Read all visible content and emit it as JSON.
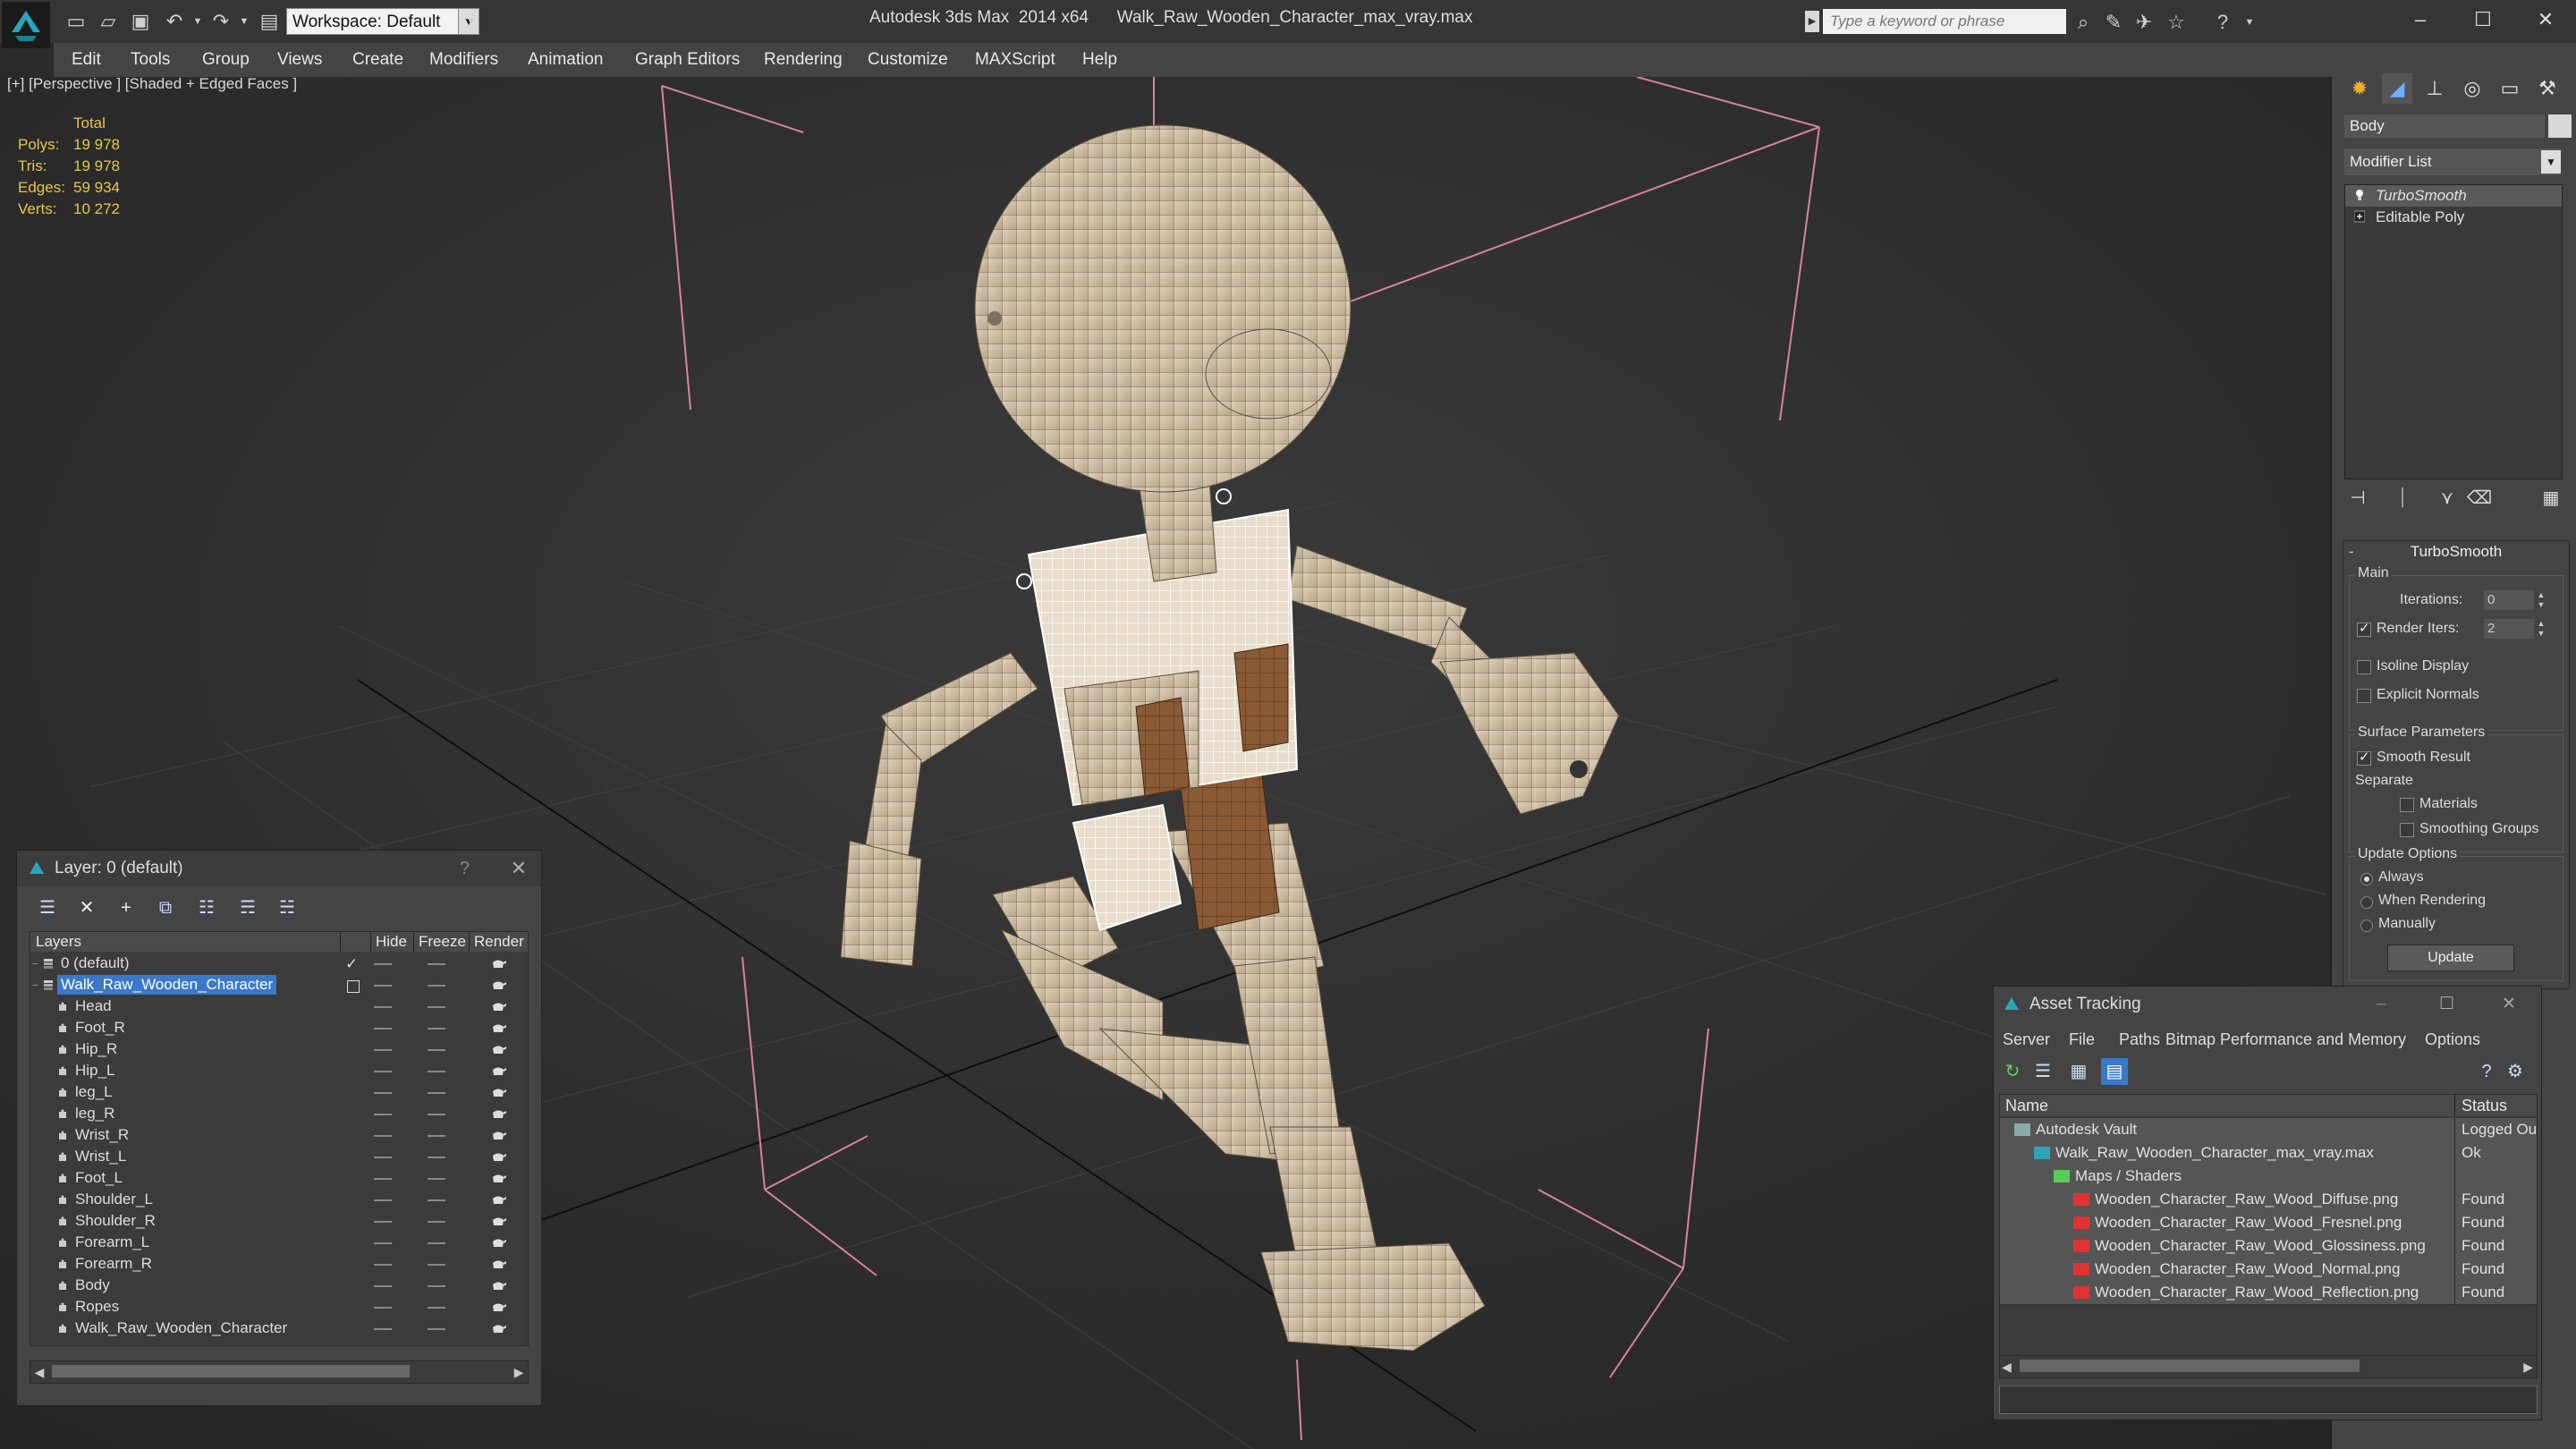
{
  "app": {
    "title": "Autodesk 3ds Max  2014 x64",
    "file": "Walk_Raw_Wooden_Character_max_vray.max",
    "workspace": "Workspace: Default",
    "search_placeholder": "Type a keyword or phrase",
    "logo_icon": "3dsmax-logo-icon",
    "accent": "#3a78c8"
  },
  "menu": [
    "Edit",
    "Tools",
    "Group",
    "Views",
    "Create",
    "Modifiers",
    "Animation",
    "Graph Editors",
    "Rendering",
    "Customize",
    "MAXScript",
    "Help"
  ],
  "viewport": {
    "label": "[+] [Perspective ] [Shaded + Edged Faces ]",
    "stats_header": "Total",
    "stats": [
      {
        "k": "Polys:",
        "v": "19 978"
      },
      {
        "k": "Tris:",
        "v": "19 978"
      },
      {
        "k": "Edges:",
        "v": "59 934"
      },
      {
        "k": "Verts:",
        "v": "10 272"
      }
    ]
  },
  "command_panel": {
    "tabs": [
      "create-icon",
      "modify-icon",
      "hierarchy-icon",
      "motion-icon",
      "display-icon",
      "utilities-icon"
    ],
    "object_name": "Body",
    "modifier_list": "Modifier List",
    "stack": [
      {
        "label": "TurboSmooth",
        "selected": true
      },
      {
        "label": "Editable Poly",
        "selected": false
      }
    ],
    "rollout": {
      "title": "TurboSmooth",
      "main_label": "Main",
      "iterations_label": "Iterations:",
      "iterations_value": "0",
      "render_iters_label": "Render Iters:",
      "render_iters_value": "2",
      "render_iters_checked": true,
      "isoline": "Isoline Display",
      "explicit": "Explicit Normals",
      "surface_label": "Surface Parameters",
      "smooth_result": "Smooth Result",
      "separate": "Separate",
      "materials": "Materials",
      "smoothing_groups": "Smoothing Groups",
      "update_label": "Update Options",
      "always": "Always",
      "when_rendering": "When Rendering",
      "manually": "Manually",
      "update_button": "Update"
    }
  },
  "layer_dialog": {
    "title": "Layer: 0 (default)",
    "help": "?",
    "columns": {
      "layers": "Layers",
      "hide": "Hide",
      "freeze": "Freeze",
      "render": "Render"
    },
    "rows": [
      {
        "name": "0 (default)",
        "indent": 1,
        "layer": true,
        "sel": false,
        "active": true
      },
      {
        "name": "Walk_Raw_Wooden_Character",
        "indent": 1,
        "layer": true,
        "sel": true,
        "active": false
      },
      {
        "name": "Head",
        "indent": 2
      },
      {
        "name": "Foot_R",
        "indent": 2
      },
      {
        "name": "Hip_R",
        "indent": 2
      },
      {
        "name": "Hip_L",
        "indent": 2
      },
      {
        "name": "leg_L",
        "indent": 2
      },
      {
        "name": "leg_R",
        "indent": 2
      },
      {
        "name": "Wrist_R",
        "indent": 2
      },
      {
        "name": "Wrist_L",
        "indent": 2
      },
      {
        "name": "Foot_L",
        "indent": 2
      },
      {
        "name": "Shoulder_L",
        "indent": 2
      },
      {
        "name": "Shoulder_R",
        "indent": 2
      },
      {
        "name": "Forearm_L",
        "indent": 2
      },
      {
        "name": "Forearm_R",
        "indent": 2
      },
      {
        "name": "Body",
        "indent": 2
      },
      {
        "name": "Ropes",
        "indent": 2
      },
      {
        "name": "Walk_Raw_Wooden_Character",
        "indent": 2
      }
    ]
  },
  "asset_tracking": {
    "title": "Asset Tracking",
    "menu": [
      "Server",
      "File",
      "Paths",
      "Bitmap Performance and Memory",
      "Options"
    ],
    "columns": {
      "name": "Name",
      "status": "Status"
    },
    "rows": [
      {
        "name": "Autodesk Vault",
        "status": "Logged Ou",
        "indent": 0,
        "icon": "vault-icon"
      },
      {
        "name": "Walk_Raw_Wooden_Character_max_vray.max",
        "status": "Ok",
        "indent": 1,
        "icon": "max-file-icon"
      },
      {
        "name": "Maps / Shaders",
        "status": "",
        "indent": 2,
        "icon": "maps-folder-icon"
      },
      {
        "name": "Wooden_Character_Raw_Wood_Diffuse.png",
        "status": "Found",
        "indent": 3,
        "icon": "png-icon"
      },
      {
        "name": "Wooden_Character_Raw_Wood_Fresnel.png",
        "status": "Found",
        "indent": 3,
        "icon": "png-icon"
      },
      {
        "name": "Wooden_Character_Raw_Wood_Glossiness.png",
        "status": "Found",
        "indent": 3,
        "icon": "png-icon"
      },
      {
        "name": "Wooden_Character_Raw_Wood_Normal.png",
        "status": "Found",
        "indent": 3,
        "icon": "png-icon"
      },
      {
        "name": "Wooden_Character_Raw_Wood_Reflection.png",
        "status": "Found",
        "indent": 3,
        "icon": "png-icon"
      }
    ]
  }
}
